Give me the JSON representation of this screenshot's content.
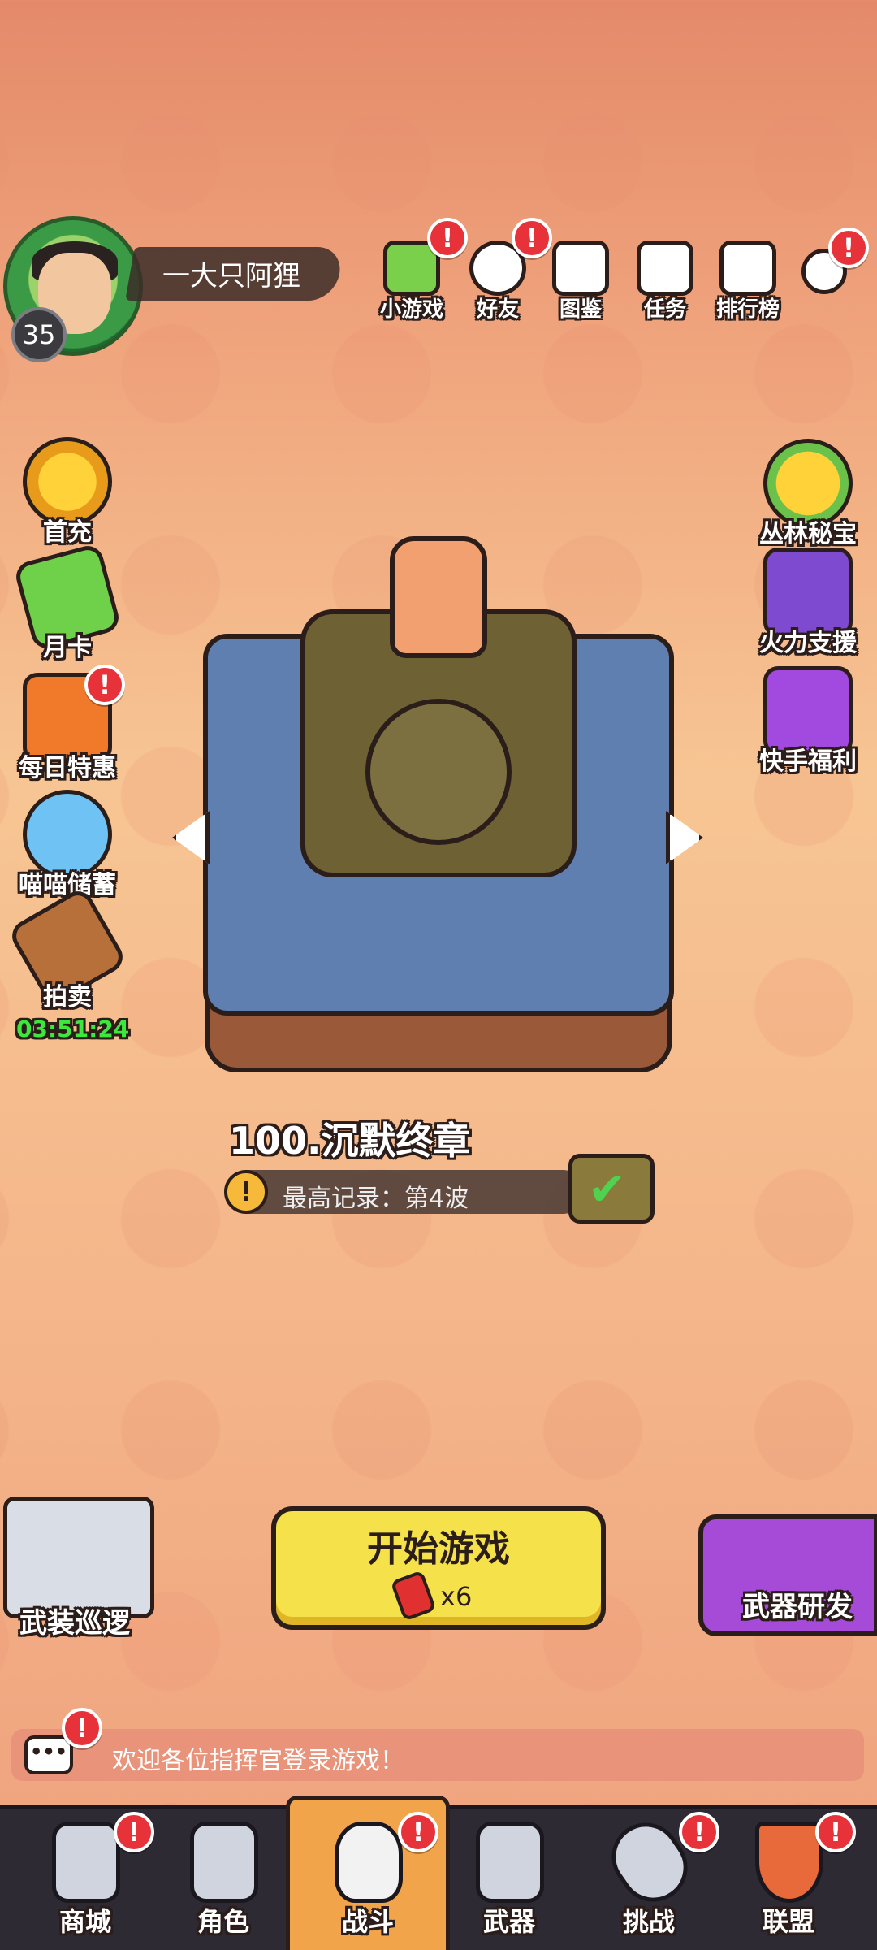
{
  "player": {
    "name": "一大只阿狸",
    "level": "35"
  },
  "top_menu": [
    {
      "label": "小游戏",
      "icon": "minigame-icon",
      "badge": "!"
    },
    {
      "label": "好友",
      "icon": "friends-icon",
      "badge": "!"
    },
    {
      "label": "图鉴",
      "icon": "codex-icon",
      "badge": ""
    },
    {
      "label": "任务",
      "icon": "tasks-icon",
      "badge": ""
    },
    {
      "label": "排行榜",
      "icon": "leaderboard-icon",
      "badge": ""
    },
    {
      "label": "",
      "icon": "gamepad-icon",
      "badge": "!"
    }
  ],
  "left_menu": [
    {
      "label": "首充",
      "icon": "first-recharge-icon",
      "badge": ""
    },
    {
      "label": "月卡",
      "icon": "monthly-card-icon",
      "badge": ""
    },
    {
      "label": "每日特惠",
      "icon": "daily-deal-icon",
      "badge": "!"
    },
    {
      "label": "喵喵储蓄",
      "icon": "cat-savings-icon",
      "badge": ""
    },
    {
      "label": "拍卖",
      "icon": "auction-gavel-icon",
      "badge": "",
      "timer": "03:51:24"
    }
  ],
  "right_menu": [
    {
      "label": "丛林秘宝",
      "icon": "jungle-treasure-icon"
    },
    {
      "label": "火力支援",
      "icon": "fire-support-icon"
    },
    {
      "label": "快手福利",
      "icon": "kuaishou-welfare-icon"
    }
  ],
  "stage": {
    "title": "100.沉默终章",
    "record": "最高记录：第4波",
    "record_icon": "!"
  },
  "actions": {
    "start_label": "开始游戏",
    "start_cost": "x6",
    "patrol_label": "武装巡逻",
    "weapon_dev_label": "武器研发"
  },
  "chat": {
    "message": "欢迎各位指挥官登录游戏！",
    "badge": "!"
  },
  "bottom_nav": [
    {
      "label": "商城",
      "icon": "shop-icon",
      "badge": "!"
    },
    {
      "label": "角色",
      "icon": "character-icon",
      "badge": ""
    },
    {
      "label": "战斗",
      "icon": "battle-icon",
      "badge": "!",
      "active": true
    },
    {
      "label": "武器",
      "icon": "weapon-icon",
      "badge": ""
    },
    {
      "label": "挑战",
      "icon": "challenge-icon",
      "badge": "!"
    },
    {
      "label": "联盟",
      "icon": "alliance-icon",
      "badge": "!"
    }
  ],
  "colors": {
    "accent": "#f5e24a",
    "badge": "#e8323a",
    "nav_bg": "#2d2a33",
    "timer": "#3ce83c"
  }
}
